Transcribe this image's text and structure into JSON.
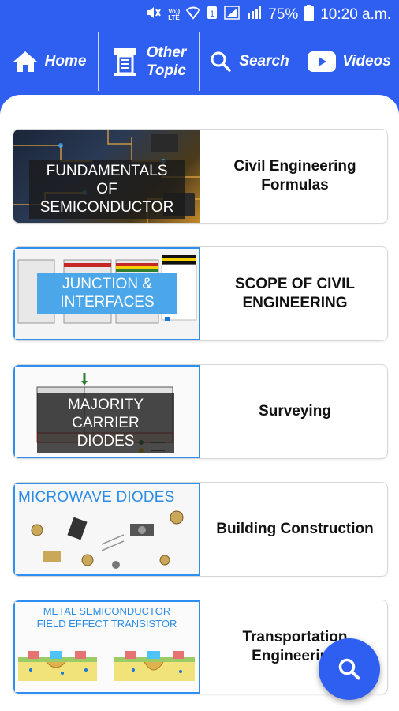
{
  "status": {
    "battery": "75%",
    "time": "10:20 a.m.",
    "volte": "Vo))\nLTE"
  },
  "nav": {
    "home": "Home",
    "other_topic_line1": "Other",
    "other_topic_line2": "Topic",
    "search": "Search",
    "videos": "Videos"
  },
  "cards": [
    {
      "thumb_text_line1": "FUNDAMENTALS OF",
      "thumb_text_line2": "SEMICONDUCTOR",
      "title": "Civil Engineering Formulas"
    },
    {
      "thumb_text_line1": "JUNCTION &",
      "thumb_text_line2": "INTERFACES",
      "title": "SCOPE OF CIVIL ENGINEERING"
    },
    {
      "thumb_text_line1": "MAJORITY",
      "thumb_text_line2": "CARRIER DIODES",
      "title": "Surveying"
    },
    {
      "thumb_text_line1": "MICROWAVE DIODES",
      "title": "Building Construction"
    },
    {
      "thumb_text_line1": "METAL SEMICONDUCTOR",
      "thumb_text_line2": "FIELD EFFECT TRANSISTOR",
      "title": "Transportation Engineering"
    }
  ],
  "colors": {
    "primary": "#2f5ff0",
    "accent_blue": "#4ba7ea",
    "youtube_red": "#ff0000"
  }
}
